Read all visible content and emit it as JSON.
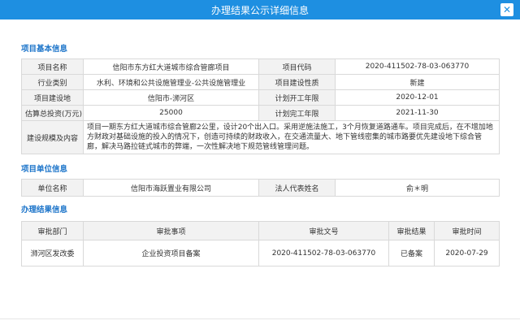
{
  "window": {
    "title": "办理结果公示详细信息",
    "close_icon": "close-icon"
  },
  "basic": {
    "heading": "项目基本信息",
    "rows": [
      [
        "项目名称",
        "信阳市东方红大道城市综合管廊项目",
        "项目代码",
        "2020-411502-78-03-063770"
      ],
      [
        "行业类别",
        "水利、环境和公共设施管理业-公共设施管理业",
        "项目建设性质",
        "新建"
      ],
      [
        "项目建设地",
        "信阳市-浉河区",
        "计划开工年限",
        "2020-12-01"
      ],
      [
        "估算总投资(万元)",
        "25000",
        "计划完工年限",
        "2021-11-30"
      ]
    ],
    "scale_label": "建设规模及内容",
    "scale_value": "项目一期东方红大道城市综合管廊2公里，设计20个出入口。采用逆施法施工，3个月恢复道路通车。项目完成后，在不增加地方财政对基础设施的投入的情况下，创造可持续的财政收入，在交通流量大、地下管线密集的城市路要优先建设地下综合管廊，解决马路拉链式城市的弊端，一次性解决地下规范管线管理问题。"
  },
  "unit": {
    "heading": "项目单位信息",
    "row": [
      "单位名称",
      "信阳市海跃置业有限公司",
      "法人代表姓名",
      "俞＊明"
    ]
  },
  "result": {
    "heading": "办理结果信息",
    "headers": [
      "审批部门",
      "审批事项",
      "审批文号",
      "审批结果",
      "审批时间"
    ],
    "rows": [
      [
        "浉河区发改委",
        "企业投资项目备案",
        "2020-411502-78-03-063770",
        "已备案",
        "2020-07-29"
      ]
    ]
  }
}
